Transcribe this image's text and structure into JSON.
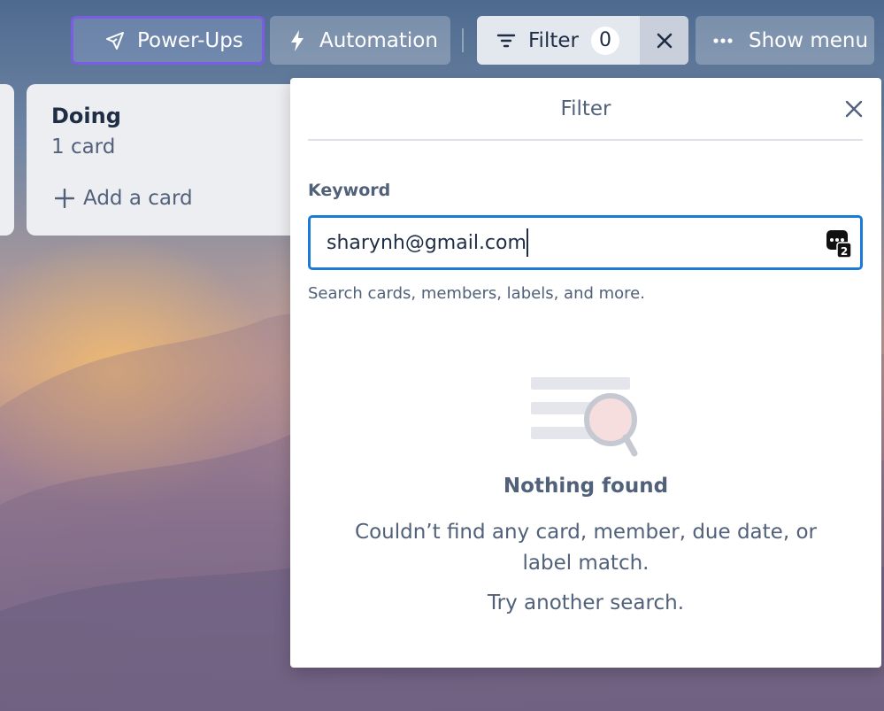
{
  "toolbar": {
    "powerups_label": "Power-Ups",
    "automation_label": "Automation",
    "filter_label": "Filter",
    "filter_count": "0",
    "show_menu_label": "Show menu"
  },
  "list": {
    "title": "Doing",
    "card_count": "1 card",
    "add_card_label": "Add a card"
  },
  "filter_panel": {
    "title": "Filter",
    "keyword_label": "Keyword",
    "keyword_value": "sharynh@gmail.com",
    "help_text": "Search cards, members, labels, and more.",
    "empty_title": "Nothing found",
    "empty_description": "Couldn’t find any card, member, due date, or label match.",
    "empty_hint": "Try another search."
  },
  "colors": {
    "focus_border": "#1d7bd8",
    "powerups_border": "#7a5de0",
    "text_dark": "#1f2d45",
    "text_muted": "#51617a"
  },
  "icons": {
    "powerups": "rocket-icon",
    "automation": "lightning-icon",
    "filter": "filter-icon",
    "clear": "close-icon",
    "menu": "more-dots-icon",
    "add": "plus-icon",
    "extension": "password-manager-icon",
    "empty": "search-empty-illustration"
  }
}
